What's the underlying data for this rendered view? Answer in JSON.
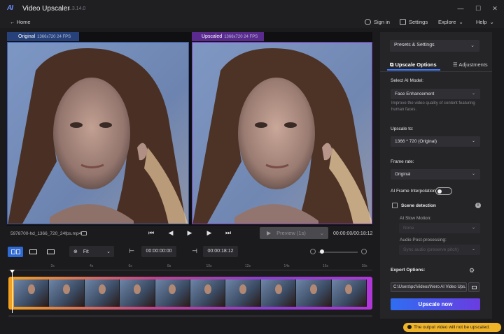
{
  "app": {
    "logo": "AI",
    "title": "Video Upscaler",
    "version": "1.3.14.0"
  },
  "window_controls": {
    "minimize": "—",
    "maximize": "☐",
    "close": "✕"
  },
  "nav": {
    "home": "← Home",
    "sign_in": "Sign in",
    "settings": "Settings",
    "explore": "Explore",
    "help": "Help"
  },
  "preview": {
    "original_label": "Original",
    "original_meta": "1366x720 24 FPS",
    "upscaled_label": "Upscaled",
    "upscaled_meta": "1366x720 24 FPS"
  },
  "player": {
    "filename": "5978700-hd_1366_720_24fps.mp4",
    "preview_label": "Preview (1s)",
    "time": "00:00:00/00:18:12"
  },
  "toolbar": {
    "zoom": "Fit",
    "start_time": "00:00:00:00",
    "end_time": "00:00:18:12"
  },
  "timeline": {
    "ticks": [
      "",
      "2s",
      "4s",
      "6s",
      "8s",
      "10s",
      "12s",
      "14s",
      "16s",
      "18s"
    ],
    "thumb_count": 10
  },
  "panel": {
    "presets": "Presets & Settings",
    "tab_options": "Upscale Options",
    "tab_adjustments": "Adjustments",
    "model_label": "Select AI Model:",
    "model_value": "Face Enhancement",
    "model_desc": "Improve the video quality of content featuring human faces.",
    "upscale_label": "Upscale to:",
    "upscale_value": "1366 * 720 (Original)",
    "framerate_label": "Frame rate:",
    "framerate_value": "Original",
    "interpolation_label": "AI Frame Interpolation",
    "interpolation_on": false,
    "scene_label": "Scene detection",
    "slowmo_label": "AI Slow Motion:",
    "slowmo_value": "None",
    "audio_label": "Audio Post-processing:",
    "audio_value": "Sync audio (preserve pitch)",
    "export_label": "Export Options:",
    "export_path": "C:\\Users\\pc\\Videos\\Nero AI Video Ups...",
    "upscale_button": "Upscale now"
  },
  "toast": "The output video will not be upscaled."
}
